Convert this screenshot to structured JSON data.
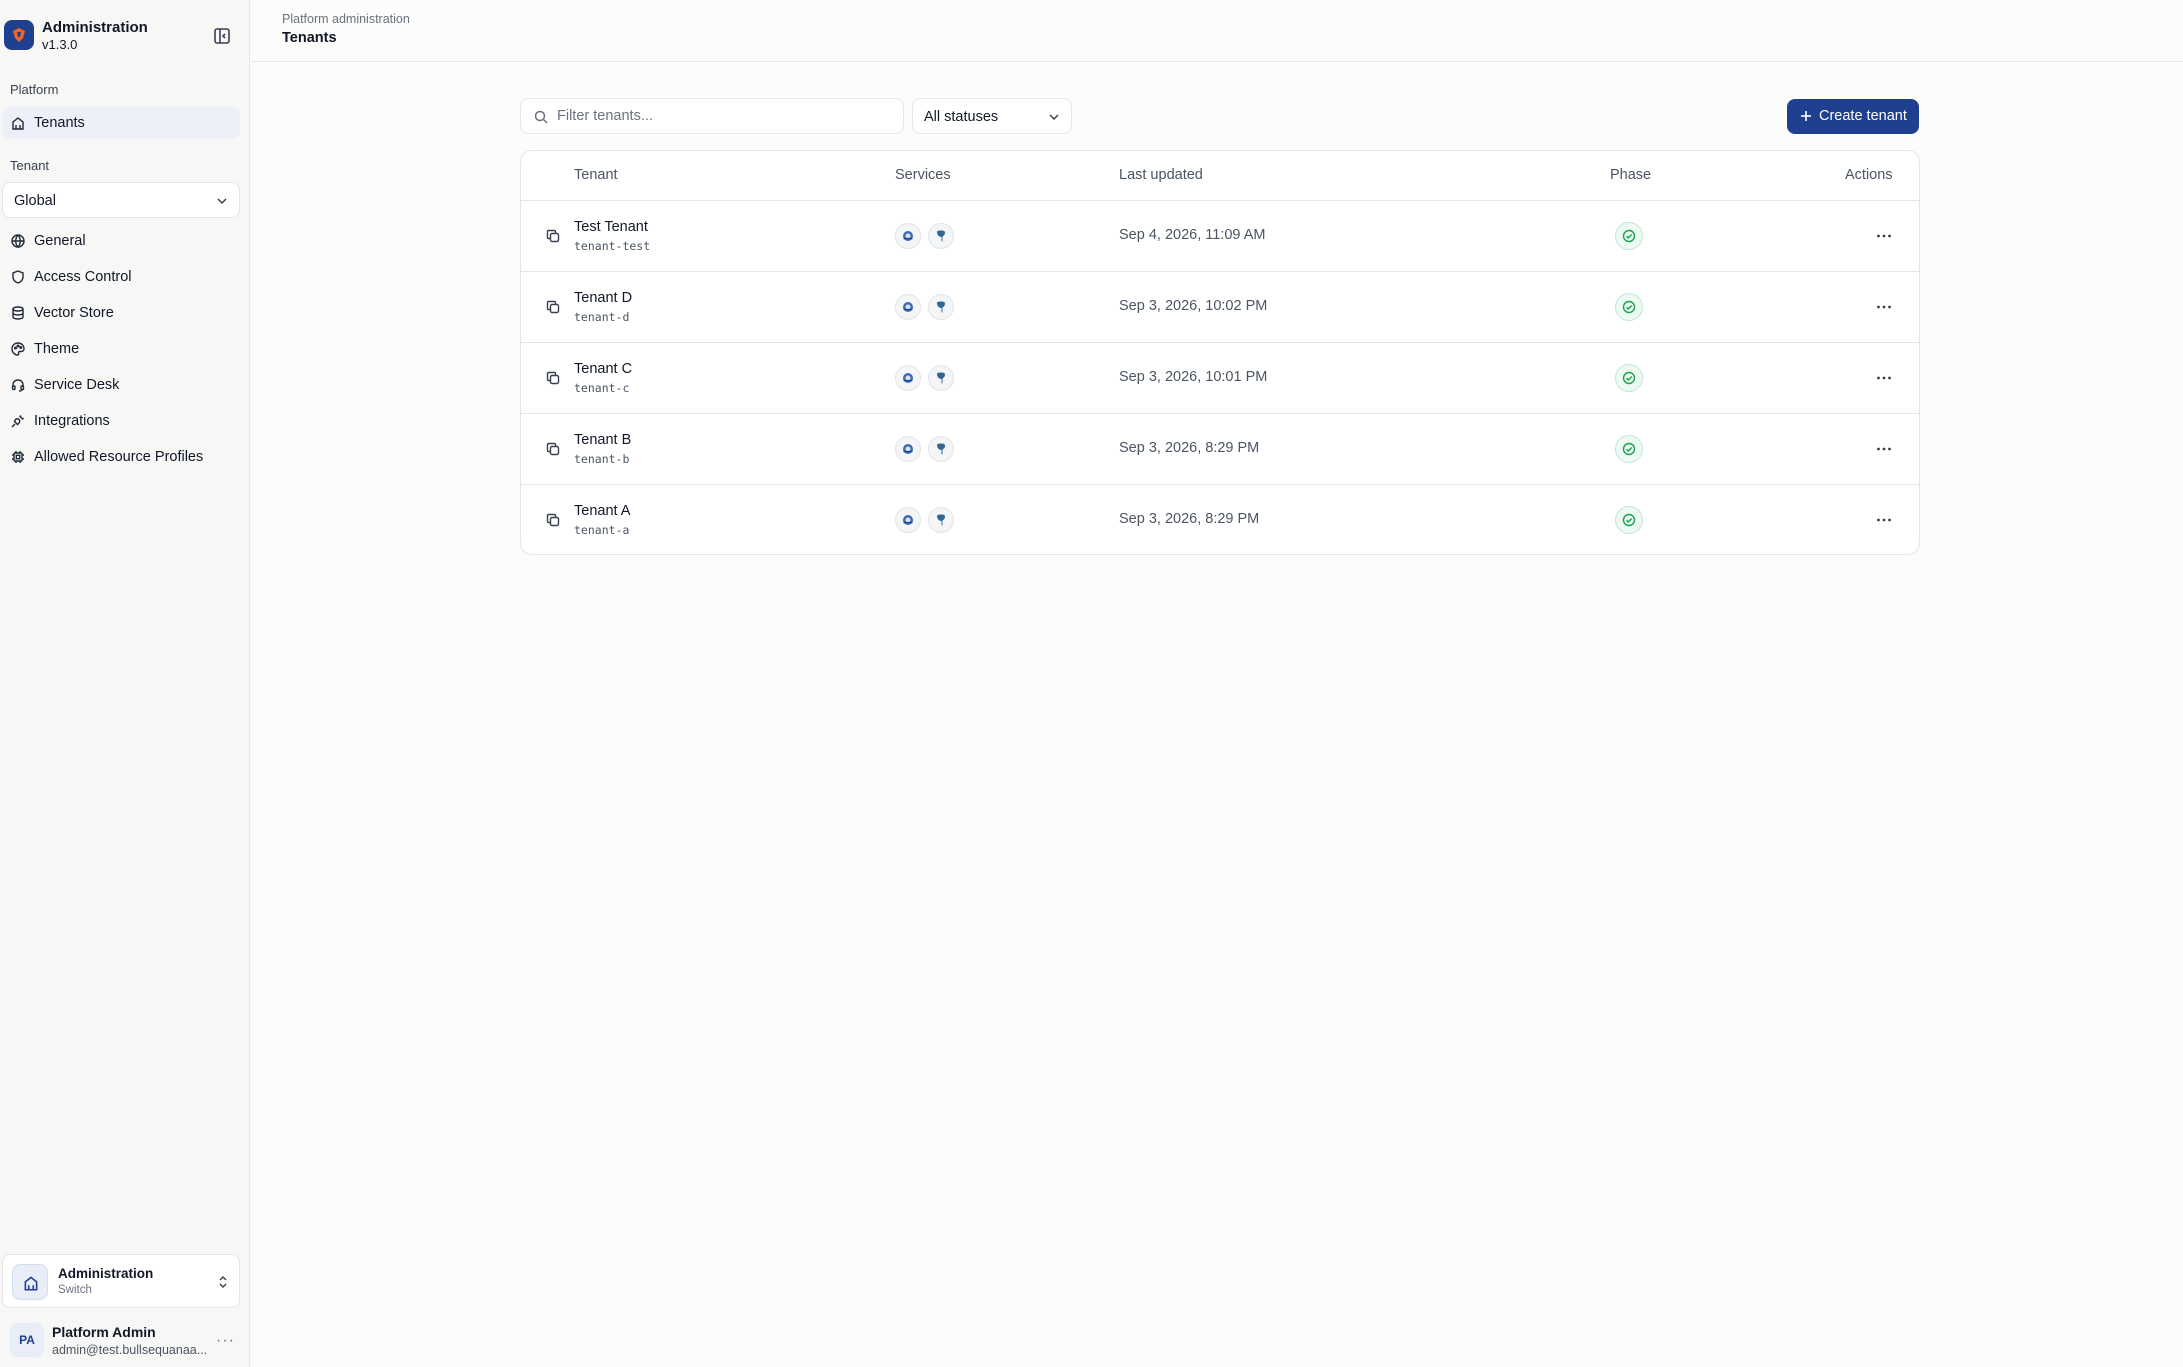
{
  "sidebar": {
    "brand": {
      "title": "Administration",
      "version": "v1.3.0"
    },
    "platform_label": "Platform",
    "platform_items": [
      {
        "label": "Tenants",
        "icon": "building-icon",
        "active": true
      }
    ],
    "tenant_label": "Tenant",
    "tenant_select": {
      "value": "Global"
    },
    "tenant_items": [
      {
        "label": "General",
        "icon": "globe-icon"
      },
      {
        "label": "Access Control",
        "icon": "shield-icon"
      },
      {
        "label": "Vector Store",
        "icon": "database-icon"
      },
      {
        "label": "Theme",
        "icon": "palette-icon"
      },
      {
        "label": "Service Desk",
        "icon": "headset-icon"
      },
      {
        "label": "Integrations",
        "icon": "plug-icon"
      },
      {
        "label": "Allowed Resource Profiles",
        "icon": "cpu-icon"
      }
    ],
    "org_switcher": {
      "title": "Administration",
      "subtitle": "Switch"
    },
    "user": {
      "initials": "PA",
      "name": "Platform Admin",
      "email": "admin@test.bullsequanaa..."
    }
  },
  "header": {
    "breadcrumb_parent": "Platform administration",
    "breadcrumb_current": "Tenants"
  },
  "toolbar": {
    "search_placeholder": "Filter tenants...",
    "status_filter": "All statuses",
    "create_label": "Create tenant"
  },
  "table": {
    "columns": [
      "Tenant",
      "Services",
      "Last updated",
      "Phase",
      "Actions"
    ],
    "rows": [
      {
        "name": "Test Tenant",
        "slug": "tenant-test",
        "updated": "Sep 4, 2026, 11:09 AM",
        "phase": "ready"
      },
      {
        "name": "Tenant D",
        "slug": "tenant-d",
        "updated": "Sep 3, 2026, 10:02 PM",
        "phase": "ready"
      },
      {
        "name": "Tenant C",
        "slug": "tenant-c",
        "updated": "Sep 3, 2026, 10:01 PM",
        "phase": "ready"
      },
      {
        "name": "Tenant B",
        "slug": "tenant-b",
        "updated": "Sep 3, 2026, 8:29 PM",
        "phase": "ready"
      },
      {
        "name": "Tenant A",
        "slug": "tenant-a",
        "updated": "Sep 3, 2026, 8:29 PM",
        "phase": "ready"
      }
    ]
  },
  "colors": {
    "accent": "#1f3f8f",
    "success": "#16a34a",
    "border": "#e5e5e3"
  }
}
